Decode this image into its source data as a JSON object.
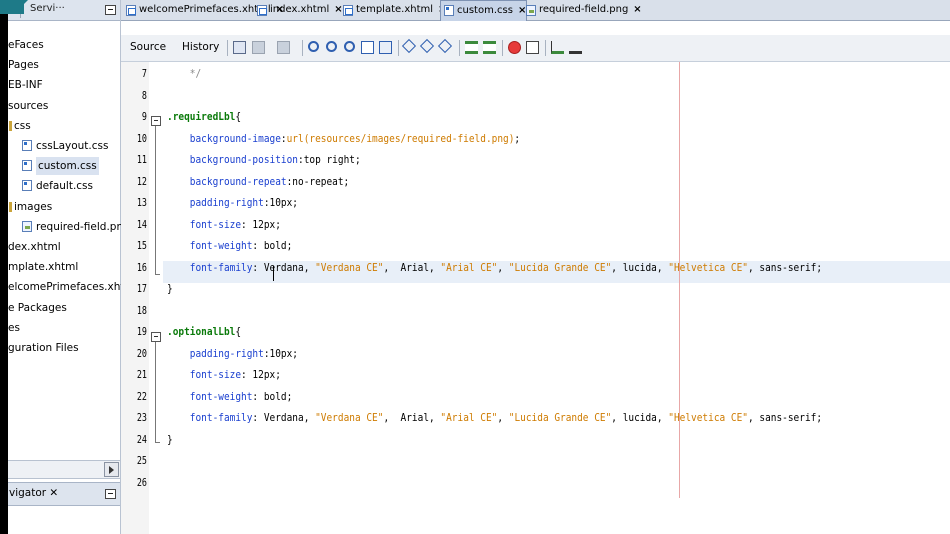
{
  "left_panel": {
    "tabs": [
      "s",
      "Servi···"
    ],
    "tree": [
      {
        "label": "eFaces",
        "icon": "none",
        "indent": 0
      },
      {
        "label": "Pages",
        "icon": "none",
        "indent": 0
      },
      {
        "label": "EB-INF",
        "icon": "none",
        "indent": 0
      },
      {
        "label": "sources",
        "icon": "none",
        "indent": 0
      },
      {
        "label": "css",
        "icon": "folder",
        "indent": 1
      },
      {
        "label": "cssLayout.css",
        "icon": "css",
        "indent": 2
      },
      {
        "label": "custom.css",
        "icon": "css",
        "indent": 2,
        "selected": true
      },
      {
        "label": "default.css",
        "icon": "css",
        "indent": 2
      },
      {
        "label": "images",
        "icon": "folder",
        "indent": 1
      },
      {
        "label": "required-field.png",
        "icon": "image",
        "indent": 2
      },
      {
        "label": "dex.xhtml",
        "icon": "none",
        "indent": 0
      },
      {
        "label": "mplate.xhtml",
        "icon": "none",
        "indent": 0
      },
      {
        "label": "elcomePrimefaces.xhtml",
        "icon": "none",
        "indent": 0
      },
      {
        "label": "e Packages",
        "icon": "none",
        "indent": 0
      },
      {
        "label": "es",
        "icon": "none",
        "indent": 0
      },
      {
        "label": "guration Files",
        "icon": "none",
        "indent": 0
      }
    ],
    "navigator_label": "vigator ✕"
  },
  "editor": {
    "tabs": [
      {
        "label": "welcomePrimefaces.xhtml",
        "icon": "xhtml-icon",
        "active": false
      },
      {
        "label": "index.xhtml",
        "icon": "xhtml-icon",
        "active": false
      },
      {
        "label": "template.xhtml",
        "icon": "xhtml-icon",
        "active": false
      },
      {
        "label": "custom.css",
        "icon": "css-icon",
        "active": true
      },
      {
        "label": "required-field.png",
        "icon": "image-icon",
        "active": false
      }
    ],
    "toolbar": {
      "source_label": "Source",
      "history_label": "History"
    },
    "line_numbers": [
      "7",
      "8",
      "9",
      "10",
      "11",
      "12",
      "13",
      "14",
      "15",
      "16",
      "17",
      "18",
      "19",
      "20",
      "21",
      "22",
      "23",
      "24",
      "25",
      "26"
    ],
    "code_lines": [
      [
        {
          "t": "*/",
          "c": "cmt",
          "indent": 1
        }
      ],
      [],
      [
        {
          "t": ".requiredLbl",
          "c": "sel"
        },
        {
          "t": "{",
          "c": "val"
        }
      ],
      [
        {
          "t": "background-image",
          "c": "prop",
          "indent": 1
        },
        {
          "t": ":",
          "c": "val"
        },
        {
          "t": "url(resources/images/required-field.png)",
          "c": "str"
        },
        {
          "t": ";",
          "c": "val"
        }
      ],
      [
        {
          "t": "background-position",
          "c": "prop",
          "indent": 1
        },
        {
          "t": ":top right;",
          "c": "val"
        }
      ],
      [
        {
          "t": "background-repeat",
          "c": "prop",
          "indent": 1
        },
        {
          "t": ":no-repeat;",
          "c": "val"
        }
      ],
      [
        {
          "t": "padding-right",
          "c": "prop",
          "indent": 1
        },
        {
          "t": ":10px;",
          "c": "val"
        }
      ],
      [
        {
          "t": "font-size",
          "c": "prop",
          "indent": 1
        },
        {
          "t": ": 12px;",
          "c": "val"
        }
      ],
      [
        {
          "t": "font-weight",
          "c": "prop",
          "indent": 1
        },
        {
          "t": ": bold;",
          "c": "val"
        }
      ],
      [
        {
          "t": "font-family",
          "c": "prop",
          "indent": 1
        },
        {
          "t": ": Verdana, ",
          "c": "val"
        },
        {
          "t": "\"Verdana CE\"",
          "c": "str"
        },
        {
          "t": ",  Arial, ",
          "c": "val"
        },
        {
          "t": "\"Arial CE\"",
          "c": "str"
        },
        {
          "t": ", ",
          "c": "val"
        },
        {
          "t": "\"Lucida Grande CE\"",
          "c": "str"
        },
        {
          "t": ", lucida, ",
          "c": "val"
        },
        {
          "t": "\"Helvetica CE\"",
          "c": "str"
        },
        {
          "t": ", sans-serif;",
          "c": "val"
        }
      ],
      [
        {
          "t": "}",
          "c": "val"
        }
      ],
      [],
      [
        {
          "t": ".optionalLbl",
          "c": "sel"
        },
        {
          "t": "{",
          "c": "val"
        }
      ],
      [
        {
          "t": "padding-right",
          "c": "prop",
          "indent": 1
        },
        {
          "t": ":10px;",
          "c": "val"
        }
      ],
      [
        {
          "t": "font-size",
          "c": "prop",
          "indent": 1
        },
        {
          "t": ": 12px;",
          "c": "val"
        }
      ],
      [
        {
          "t": "font-weight",
          "c": "prop",
          "indent": 1
        },
        {
          "t": ": bold;",
          "c": "val"
        }
      ],
      [
        {
          "t": "font-family",
          "c": "prop",
          "indent": 1
        },
        {
          "t": ": Verdana, ",
          "c": "val"
        },
        {
          "t": "\"Verdana CE\"",
          "c": "str"
        },
        {
          "t": ",  Arial, ",
          "c": "val"
        },
        {
          "t": "\"Arial CE\"",
          "c": "str"
        },
        {
          "t": ", ",
          "c": "val"
        },
        {
          "t": "\"Lucida Grande CE\"",
          "c": "str"
        },
        {
          "t": ", lucida, ",
          "c": "val"
        },
        {
          "t": "\"Helvetica CE\"",
          "c": "str"
        },
        {
          "t": ", sans-serif;",
          "c": "val"
        }
      ],
      [
        {
          "t": "}",
          "c": "val"
        }
      ],
      [],
      []
    ]
  },
  "colors": {
    "selector": "#0a7a0a",
    "property": "#1a3fcf",
    "string": "#ce7b00",
    "comment": "#888888",
    "current_line": "#e8eff8",
    "right_margin": "#e8a7a7"
  }
}
